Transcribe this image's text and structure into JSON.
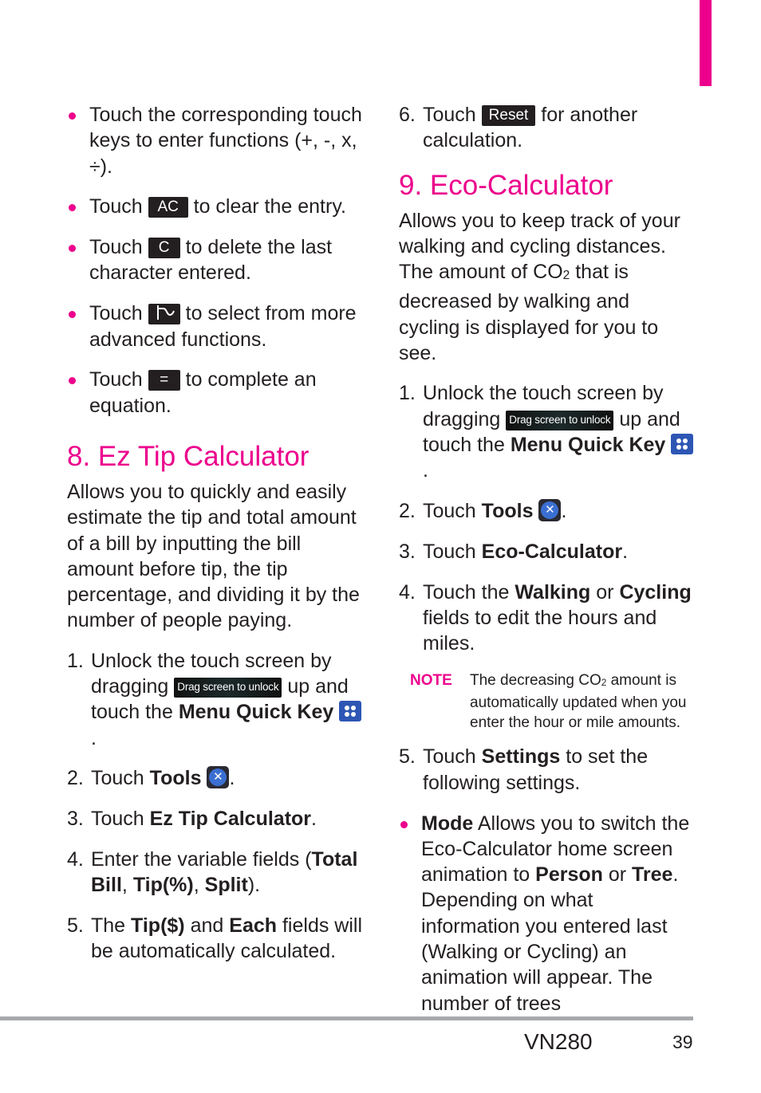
{
  "colors": {
    "accent": "#ec008c",
    "text": "#231f20",
    "rule": "#a7a9ac",
    "key_bg": "#231f20"
  },
  "left": {
    "bullets": [
      {
        "text": "Touch the corresponding touch keys to enter functions (+, -, x, ÷)."
      },
      {
        "pre": "Touch",
        "key": "AC",
        "post": "to clear the entry."
      },
      {
        "pre": "Touch",
        "key": "C",
        "post": "to delete the last character entered."
      },
      {
        "pre": "Touch",
        "key_icon": "advanced-functions-icon",
        "post": "to select from more advanced functions."
      },
      {
        "pre": "Touch",
        "key": "=",
        "post": "to complete an equation."
      }
    ],
    "section_title": "8. Ez Tip Calculator",
    "intro": "Allows you to quickly and easily estimate the tip and total amount of a bill by inputting the bill amount before tip, the tip percentage, and dividing it by the number of people paying.",
    "steps": {
      "s1": {
        "num": "1.",
        "pre": "Unlock the touch screen by dragging",
        "drag_label": "Drag screen to unlock",
        "mid": "up and touch the",
        "bold": "Menu Quick Key",
        "end": "."
      },
      "s2": {
        "num": "2.",
        "pre": "Touch",
        "bold": "Tools",
        "end": "."
      },
      "s3": {
        "num": "3.",
        "pre": "Touch",
        "bold": "Ez Tip Calculator",
        "end": "."
      },
      "s4": {
        "num": "4.",
        "pre": "Enter the variable fields (",
        "b1": "Total Bill",
        "sep1": ", ",
        "b2": "Tip(%)",
        "sep2": ", ",
        "b3": "Split",
        "end": ")."
      },
      "s5": {
        "num": "5.",
        "pre": "The",
        "b1": "Tip($)",
        "mid": "and",
        "b2": "Each",
        "end": "fields will be automatically calculated."
      }
    }
  },
  "right": {
    "step6": {
      "num": "6.",
      "pre": "Touch",
      "key": "Reset",
      "post": "for another calculation."
    },
    "section_title": "9. Eco-Calculator",
    "intro_pre": "Allows you to keep track of your walking and cycling distances. The amount of CO",
    "intro_sub": "2",
    "intro_post": " that is decreased by walking and cycling is displayed for you to see.",
    "steps": {
      "s1": {
        "num": "1.",
        "pre": "Unlock the touch screen by dragging",
        "drag_label": "Drag screen to unlock",
        "mid": "up and touch the",
        "bold": "Menu Quick Key",
        "end": "."
      },
      "s2": {
        "num": "2.",
        "pre": "Touch",
        "bold": "Tools",
        "end": "."
      },
      "s3": {
        "num": "3.",
        "pre": "Touch",
        "bold": "Eco-Calculator",
        "end": "."
      },
      "s4": {
        "num": "4.",
        "pre": "Touch the",
        "b1": "Walking",
        "mid": "or",
        "b2": "Cycling",
        "end": "fields to edit the hours and miles."
      },
      "s5": {
        "num": "5.",
        "pre": "Touch",
        "bold": "Settings",
        "end": "to set the following settings."
      }
    },
    "note": {
      "label": "NOTE",
      "pre": "The decreasing CO",
      "sub": "2",
      "post": " amount is automatically updated when you enter the hour or mile amounts."
    },
    "mode_bullet": {
      "bold": "Mode",
      "pre": " Allows you to switch the Eco-Calculator home screen animation to ",
      "b2": "Person",
      "mid": " or ",
      "b3": "Tree",
      "post": ". Depending on what information you entered last (Walking or Cycling) an animation will appear. The number of trees"
    }
  },
  "footer": {
    "model": "VN280",
    "page": "39"
  }
}
